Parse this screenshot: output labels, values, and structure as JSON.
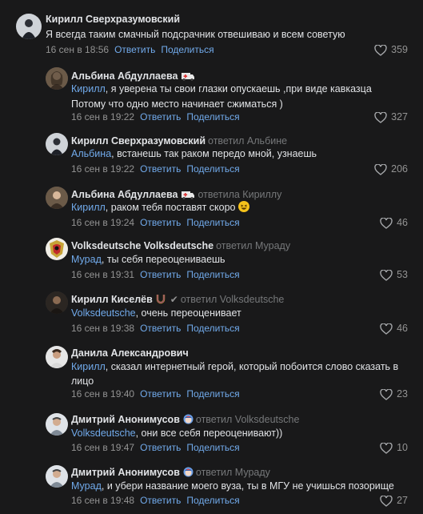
{
  "comments": [
    {
      "author": "Кирилл Сверхразумовский",
      "replied_to": "",
      "mention": "",
      "text": "Я всегда таким смачный подсрачник отвешиваю и всем советую",
      "text2": "",
      "date": "16 сен в 18:56",
      "reply_label": "Ответить",
      "share_label": "Поделиться",
      "likes": "359"
    },
    {
      "author": "Альбина Абдуллаева",
      "replied_to": "",
      "mention": "Кирилл",
      "text": ", я уверена ты свои глазки опускаешь ,при виде кавказца",
      "text2": "Потому что одно место начинает сжиматься )",
      "date": "16 сен в 19:22",
      "reply_label": "Ответить",
      "share_label": "Поделиться",
      "likes": "327"
    },
    {
      "author": "Кирилл Сверхразумовский",
      "replied_to": "ответил Альбине",
      "mention": "Альбина",
      "text": ", встанешь так раком передо мной, узнаешь",
      "text2": "",
      "date": "16 сен в 19:22",
      "reply_label": "Ответить",
      "share_label": "Поделиться",
      "likes": "206"
    },
    {
      "author": "Альбина Абдуллаева",
      "replied_to": "ответила Кириллу",
      "mention": "Кирилл",
      "text": ", раком тебя поставят скоро",
      "text2": "",
      "date": "16 сен в 19:24",
      "reply_label": "Ответить",
      "share_label": "Поделиться",
      "likes": "46"
    },
    {
      "author": "Volksdeutsche Volksdeutsche",
      "replied_to": "ответил Мураду",
      "mention": "Мурад",
      "text": ", ты себя переоцениваешь",
      "text2": "",
      "date": "16 сен в 19:31",
      "reply_label": "Ответить",
      "share_label": "Поделиться",
      "likes": "53"
    },
    {
      "author": "Кирилл Киселёв",
      "replied_to": "ответил Volksdeutsche",
      "mention": "Volksdeutsche",
      "text": ", очень переоценивает",
      "text2": "",
      "date": "16 сен в 19:38",
      "reply_label": "Ответить",
      "share_label": "Поделиться",
      "likes": "46"
    },
    {
      "author": "Данила Александрович",
      "replied_to": "",
      "mention": "Кирилл",
      "text": ", сказал интернетный герой, который побоится слово сказать в",
      "text2": "лицо",
      "date": "16 сен в 19:40",
      "reply_label": "Ответить",
      "share_label": "Поделиться",
      "likes": "23"
    },
    {
      "author": "Дмитрий Анонимусов",
      "replied_to": "ответил Volksdeutsche",
      "mention": "Volksdeutsche",
      "text": ", они все себя переоценивают))",
      "text2": "",
      "date": "16 сен в 19:47",
      "reply_label": "Ответить",
      "share_label": "Поделиться",
      "likes": "10"
    },
    {
      "author": "Дмитрий Анонимусов",
      "replied_to": "ответил Мураду",
      "mention": "Мурад",
      "text": ", и убери название моего вуза, ты в МГУ не учишься позорище",
      "text2": "",
      "date": "16 сен в 19:48",
      "reply_label": "Ответить",
      "share_label": "Поделиться",
      "likes": "27"
    }
  ]
}
